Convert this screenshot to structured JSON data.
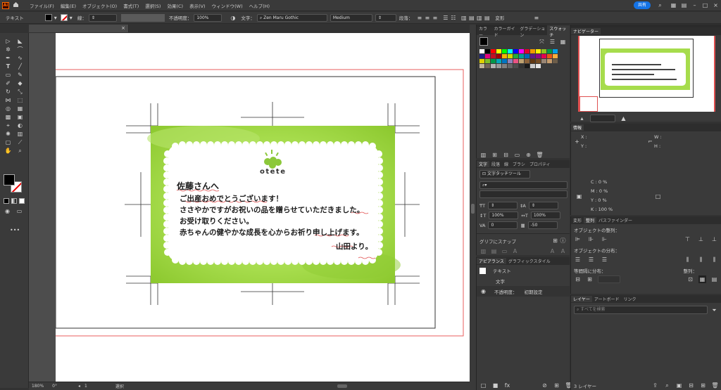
{
  "menubar": {
    "items": [
      "ファイル(F)",
      "編集(E)",
      "オブジェクト(O)",
      "書式(T)",
      "選択(S)",
      "効果(C)",
      "表示(V)",
      "ウィンドウ(W)",
      "ヘルプ(H)"
    ],
    "share": "共有"
  },
  "control": {
    "tool": "テキスト",
    "stroke_label": "線：",
    "opacity_label": "不透明度：",
    "opacity": "100%",
    "char_label": "文字：",
    "font": "Zen Maru Gothic",
    "weight": "Medium",
    "para_label": "段落：",
    "transform": "変形"
  },
  "doc_tab": {
    "close": "×"
  },
  "card": {
    "brand": "otete",
    "greeting": "佐藤さんへ",
    "lines": [
      "ご出産おめでとうございます！",
      "ささやかですがお祝いの品を贈らせていただきました。",
      "お受け取りください。",
      "赤ちゃんの健やかな成長を心からお祈り申し上げます。"
    ],
    "signature": "山田より。"
  },
  "status": {
    "zoom": "180%",
    "rotation": "0°",
    "artboard": "1",
    "mode": "選択"
  },
  "swatch_panel": {
    "tabs": [
      "カラー",
      "カラーガイド",
      "グラデーション",
      "スウォッチ"
    ],
    "colors": [
      "#ffffff",
      "#000000",
      "#ff0000",
      "#ffff00",
      "#00ff00",
      "#00ffff",
      "#0000ff",
      "#ff00ff",
      "#e4002b",
      "#f39800",
      "#fff100",
      "#8fc31f",
      "#009944",
      "#00a0e9",
      "#1d2088",
      "#e4007f",
      "#c30d23",
      "#a40000",
      "#f8b500",
      "#cfdb00",
      "#22ac38",
      "#009e96",
      "#0068b7",
      "#601986",
      "#920783",
      "#e5004f",
      "#ea5514",
      "#f6ad3c",
      "#dfd000",
      "#7fbe26",
      "#00984a",
      "#00a9bb",
      "#0075c2",
      "#8f82bc",
      "#e95383",
      "#bfa271",
      "#8c6239",
      "#603813",
      "#754c24",
      "#998675",
      "#c69c6d",
      "#6d5d49",
      "#c2b49a",
      "#736357",
      "#b3b3b3",
      "#999999",
      "#808080",
      "#666666",
      "#4d4d4d",
      "#333333",
      "#1a1a1a",
      "#cccccc",
      "#e6e6e6"
    ]
  },
  "char_panel": {
    "tabs": [
      "文字",
      "段落",
      "線",
      "ブラシ",
      "プロパティ"
    ],
    "touch": "文字タッチツール",
    "size_v": "100%",
    "size_h": "100%",
    "track": "0",
    "kern": "-50",
    "glyph_snap": "グリフにスナップ"
  },
  "appearance": {
    "tabs": [
      "アピアランス",
      "グラフィックスタイル"
    ],
    "rows": [
      "テキスト",
      "文字",
      "不透明度：",
      "初期設定"
    ]
  },
  "navigator": {
    "tabs": [
      "ナビゲーター"
    ]
  },
  "info": {
    "title": "情報",
    "x": "X :",
    "y": "Y :",
    "w": "W :",
    "h": "H :",
    "c": "C : 0 %",
    "m": "M : 0 %",
    "yy": "Y : 0 %",
    "k": "K : 100 %"
  },
  "align": {
    "tabs": [
      "変形",
      "整列",
      "パスファインダー"
    ],
    "obj_align": "オブジェクトの整列：",
    "obj_dist": "オブジェクトの分布：",
    "spacing": "等間隔に分布：",
    "align_to": "整列："
  },
  "layers": {
    "tabs": [
      "レイヤー",
      "アートボード",
      "リンク"
    ],
    "search": "すべてを検索",
    "count": "3 レイヤー"
  }
}
